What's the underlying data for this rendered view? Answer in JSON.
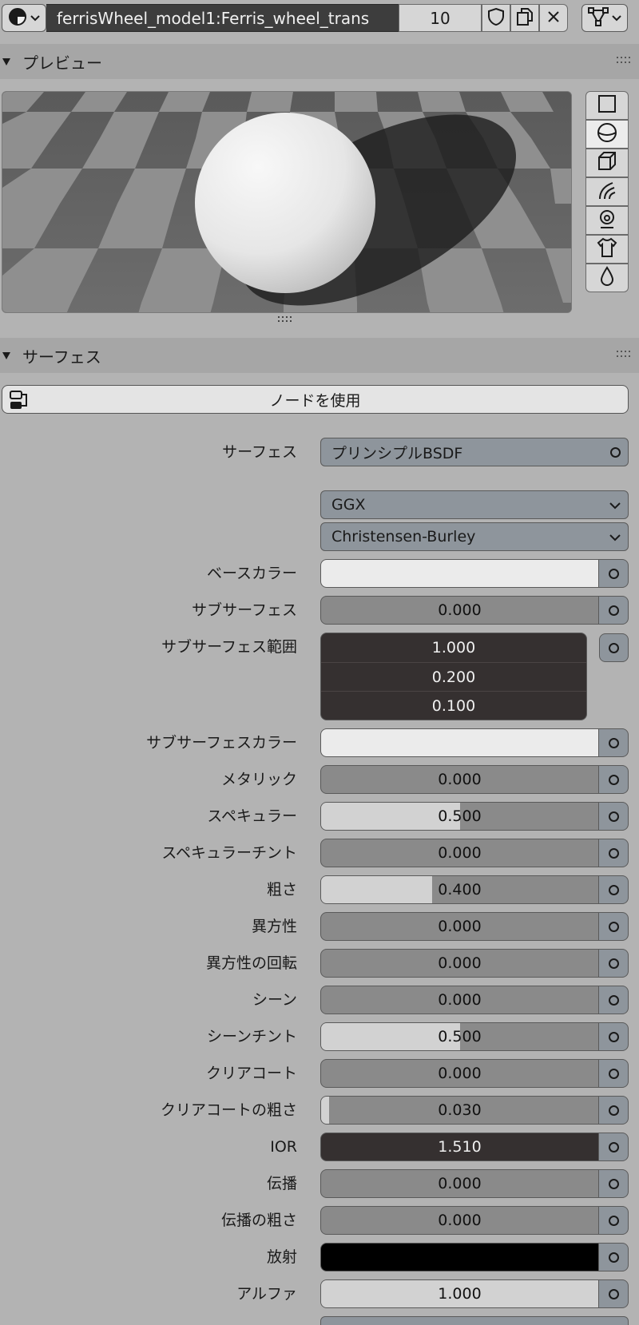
{
  "header": {
    "material_name": "ferrisWheel_model1:Ferris_wheel_trans",
    "users_count": "10",
    "icons": [
      "material-sphere-icon",
      "fake-user-shield-icon",
      "duplicate-icon",
      "close-icon",
      "node-tree-icon"
    ]
  },
  "preview": {
    "title": "プレビュー",
    "shapes": [
      "flat-icon",
      "sphere-icon",
      "cube-icon",
      "hair-icon",
      "monkey-icon",
      "cloth-icon",
      "fluid-icon"
    ],
    "active_shape": "sphere-icon"
  },
  "surface": {
    "title": "サーフェス",
    "use_nodes_label": "ノードを使用",
    "shader_label": "サーフェス",
    "shader_value": "プリンシプルBSDF",
    "distribution": "GGX",
    "subsurface_method": "Christensen-Burley",
    "props": {
      "base_color": {
        "label": "ベースカラー",
        "color": "#ebebeb"
      },
      "subsurface": {
        "label": "サブサーフェス",
        "value": "0.000",
        "fraction": 0
      },
      "subsurface_radius": {
        "label": "サブサーフェス範囲",
        "values": [
          "1.000",
          "0.200",
          "0.100"
        ]
      },
      "subsurface_color": {
        "label": "サブサーフェスカラー",
        "color": "#ebebeb"
      },
      "metallic": {
        "label": "メタリック",
        "value": "0.000",
        "fraction": 0
      },
      "specular": {
        "label": "スペキュラー",
        "value": "0.500",
        "fraction": 0.5
      },
      "specular_tint": {
        "label": "スペキュラーチント",
        "value": "0.000",
        "fraction": 0
      },
      "roughness": {
        "label": "粗さ",
        "value": "0.400",
        "fraction": 0.4
      },
      "anisotropic": {
        "label": "異方性",
        "value": "0.000",
        "fraction": 0
      },
      "anisotropic_rotation": {
        "label": "異方性の回転",
        "value": "0.000",
        "fraction": 0
      },
      "sheen": {
        "label": "シーン",
        "value": "0.000",
        "fraction": 0
      },
      "sheen_tint": {
        "label": "シーンチント",
        "value": "0.500",
        "fraction": 0.5
      },
      "clearcoat": {
        "label": "クリアコート",
        "value": "0.000",
        "fraction": 0
      },
      "clearcoat_roughness": {
        "label": "クリアコートの粗さ",
        "value": "0.030",
        "fraction": 0.03
      },
      "ior": {
        "label": "IOR",
        "value": "1.510"
      },
      "transmission": {
        "label": "伝播",
        "value": "0.000",
        "fraction": 0
      },
      "transmission_roughness": {
        "label": "伝播の粗さ",
        "value": "0.000",
        "fraction": 0
      },
      "emission": {
        "label": "放射",
        "color": "#000000"
      },
      "alpha": {
        "label": "アルファ",
        "value": "1.000",
        "fraction": 1
      }
    }
  }
}
